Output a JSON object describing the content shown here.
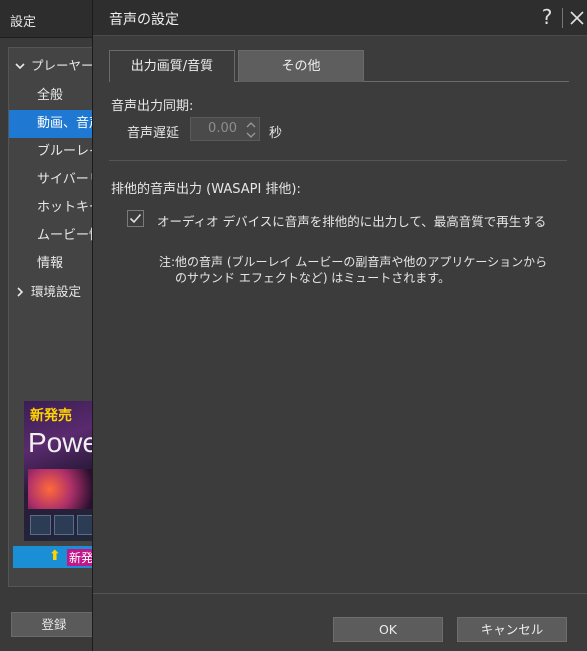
{
  "background_window": {
    "title": "設定",
    "tree": [
      {
        "label": "プレーヤーの",
        "type": "group",
        "expanded": true
      },
      {
        "label": "全般",
        "type": "item"
      },
      {
        "label": "動画、音声",
        "type": "item",
        "selected": true
      },
      {
        "label": "ブルーレイ",
        "type": "item"
      },
      {
        "label": "サイバーリン",
        "type": "item"
      },
      {
        "label": "ホットキー/",
        "type": "item"
      },
      {
        "label": "ムービー情",
        "type": "item"
      },
      {
        "label": "情報",
        "type": "item"
      },
      {
        "label": "環境設定",
        "type": "group",
        "expanded": false
      }
    ],
    "ad": {
      "new_label": "新発売",
      "title": "Powe",
      "banner_text": "新発"
    },
    "register_label": "登録"
  },
  "dialog": {
    "title": "音声の設定",
    "help_label": "?",
    "tabs": [
      {
        "label": "出力画質/音質",
        "active": false
      },
      {
        "label": "その他",
        "active": true
      }
    ],
    "sync": {
      "heading": "音声出力同期:",
      "delay_label": "音声遅延",
      "delay_value": "0.00",
      "unit": "秒"
    },
    "wasapi": {
      "heading": "排他的音声出力 (WASAPI 排他):",
      "checkbox_label": "オーディオ デバイスに音声を排他的に出力して、最高音質で再生する",
      "checked": true,
      "note_line1": "注:他の音声 (ブルーレイ ムービーの副音声や他のアプリケーションから",
      "note_line2": "のサウンド エフェクトなど) はミュートされます。"
    },
    "buttons": {
      "ok": "OK",
      "cancel": "キャンセル"
    }
  },
  "colors": {
    "selection": "#1f78d1",
    "dialog_bg": "#3c3c3c",
    "active_tab": "#5e5e5e"
  }
}
